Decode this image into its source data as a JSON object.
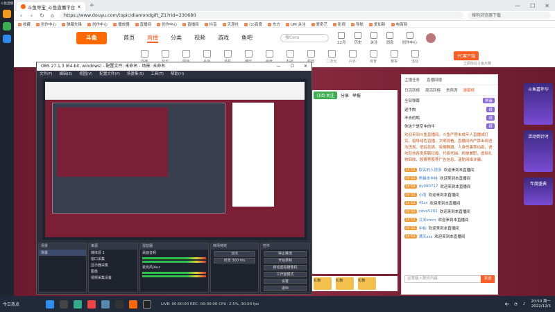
{
  "os_sidebar": {
    "top_label": "斗鱼直播"
  },
  "browser": {
    "tab_title": "斗鱼导宝_斗鱼直播平台",
    "url": "https://www.douyu.com/topic/diamondgift_Z1?rid=230680",
    "search_placeholder": "搜狗浏览器下载",
    "window_controls": [
      "—",
      "☐",
      "✕"
    ],
    "bookmarks": [
      "收藏",
      "创作中心",
      "弹幕先锋",
      "创作中心",
      "播放器",
      "直播间",
      "创作中心",
      "直播间",
      "抖音",
      "天涯社",
      "(1)百度",
      "东方",
      "UM 关注",
      "爱奇艺",
      "影视",
      "导航",
      "爱如新",
      "电商网"
    ]
  },
  "site": {
    "logo": "斗鱼",
    "nav": [
      {
        "label": "首页",
        "active": false
      },
      {
        "label": "直播",
        "active": true
      },
      {
        "label": "分类",
        "active": false
      },
      {
        "label": "视频",
        "active": false
      },
      {
        "label": "游戏",
        "active": false
      },
      {
        "label": "鱼吧",
        "active": false
      }
    ],
    "search_placeholder": "搜Cera",
    "header_icons": [
      "12月",
      "历史",
      "关注",
      "消息",
      "创作中心"
    ],
    "categories": [
      "直播",
      "音乐",
      "网游",
      "手游",
      "单机",
      "娱乐",
      "电竞",
      "科技",
      "颜值",
      "二次元",
      "户外",
      "体育",
      "赛事",
      "活动"
    ],
    "pc_button": "PC客户端",
    "side_notice": "立即前往斗鱼大赛"
  },
  "room": {
    "follow": "订阅 关注",
    "share": "分享",
    "report": "举报",
    "gifts": [
      "礼物",
      "礼物",
      "礼物"
    ]
  },
  "chat": {
    "top_links": [
      "主播任务",
      "直播回播"
    ],
    "tabs": [
      "日活跃榜",
      "周活跃榜",
      "贵宾席",
      "弹幕榜"
    ],
    "filter_label": "全部弹幕",
    "filter_pill": "屏蔽",
    "ranks": [
      {
        "name": "送牛肉",
        "tag": "续"
      },
      {
        "name": "不去的鸭",
        "tag": "续"
      },
      {
        "name": "你这个是空中的牛",
        "tag": "续"
      }
    ],
    "system_notice": "欢迎来到斗鱼直播间。斗鱼严禁未成年人直播或打赏。倡导绿色直播，文明观看，直播间内严禁出现违法违规、低俗色情、吸烟酗酒、人身伤害等内容，请勿轻信各类招聘征婚、代练代抽、刷单兼职、虚拟礼物回收、股票荐股等广告信息，谨防网络诈骗。",
    "messages": [
      {
        "lv": "LV 12",
        "nick": "取名的人很多",
        "text": "欢迎来到本直播间"
      },
      {
        "lv": "LV 12",
        "nick": "熊猫本丰桂",
        "text": "欢迎来到本直播间"
      },
      {
        "lv": "LV 12",
        "nick": "dy990717",
        "text": "欢迎来到本直播间"
      },
      {
        "lv": "LV 12",
        "nick": "小雨",
        "text": "欢迎来到本直播间"
      },
      {
        "lv": "LV 12",
        "nick": "45zz",
        "text": "欢迎来到本直播间"
      },
      {
        "lv": "LV 12",
        "nick": "cdvo5201",
        "text": "欢迎来到本直播间"
      },
      {
        "lv": "LV 12",
        "nick": "艾米kmm",
        "text": "欢迎来到本直播间"
      },
      {
        "lv": "LV 12",
        "nick": "中桂",
        "text": "欢迎来到本直播间"
      },
      {
        "lv": "LV 12",
        "nick": "满天zzz",
        "text": "欢迎来到本直播间"
      }
    ],
    "input_placeholder": "这里输入聊天内容",
    "send_label": "发送"
  },
  "promo": [
    "斗鱼嘉年华",
    "活动倒计时",
    "年度盛典"
  ],
  "obs": {
    "title": "OBS 27.1.3 (64-bit, windows) - 配置文件: 未命名 - 场景: 未命名",
    "menu": [
      "文件(F)",
      "编辑(E)",
      "视图(V)",
      "配置文件(P)",
      "场景集(S)",
      "工具(T)",
      "帮助(H)"
    ],
    "docks": {
      "scenes": {
        "title": "场景",
        "items": [
          "场景"
        ]
      },
      "sources": {
        "title": "来源",
        "items": [
          "媒体源 1",
          "窗口采集",
          "显示器采集",
          "图像",
          "视频采集设备"
        ]
      },
      "mixer": {
        "title": "混音器",
        "items": [
          "桌面音频",
          "麦克风/Aux"
        ]
      },
      "transitions": {
        "title": "转场特效",
        "items": [
          "淡出",
          "时长 300 ms"
        ]
      },
      "controls": {
        "title": "控件",
        "items": [
          "停止推流",
          "开始录制",
          "启动虚拟摄像机",
          "工作室模式",
          "设置",
          "退出"
        ]
      }
    },
    "statusbar": "LIVE: 00:00:00   REC: 00:00:00   CPU: 2.5%, 30.00 fps"
  },
  "taskbar": {
    "left_label": "今日热点",
    "clock_time": "20:50 周一",
    "clock_date": "2022/12/5",
    "lang": "中"
  }
}
